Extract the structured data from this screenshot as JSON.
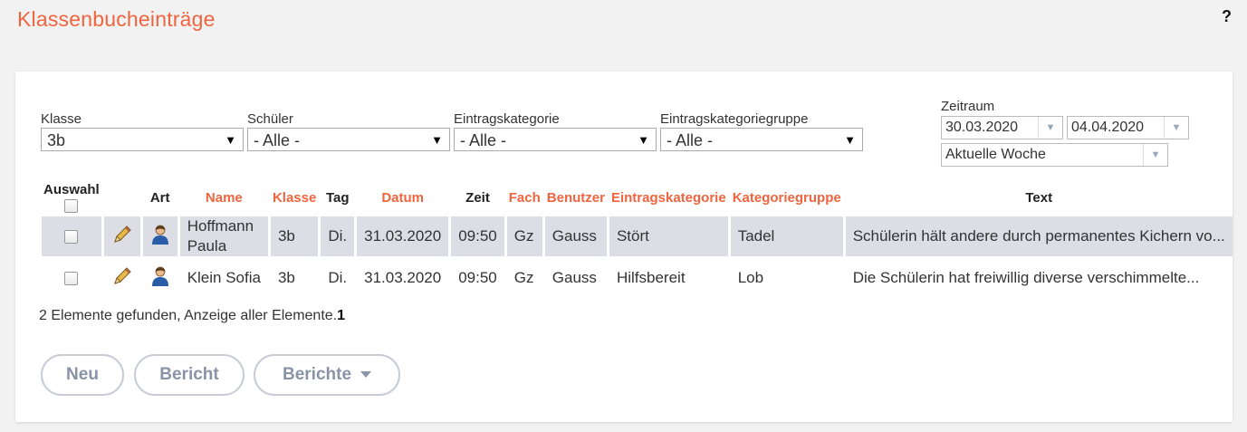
{
  "header": {
    "title": "Klassenbucheinträge",
    "help": "?"
  },
  "filters": {
    "klasse": {
      "label": "Klasse",
      "value": "3b"
    },
    "schueler": {
      "label": "Schüler",
      "value": "- Alle -"
    },
    "kategorie": {
      "label": "Eintragskategorie",
      "value": "- Alle -"
    },
    "gruppe": {
      "label": "Eintragskategoriegruppe",
      "value": "- Alle -"
    },
    "zeitraum": {
      "label": "Zeitraum",
      "from": "30.03.2020",
      "to": "04.04.2020",
      "preset": "Aktuelle Woche"
    }
  },
  "table": {
    "columns": {
      "auswahl": "Auswahl",
      "art": "Art",
      "name": "Name",
      "klasse": "Klasse",
      "tag": "Tag",
      "datum": "Datum",
      "zeit": "Zeit",
      "fach": "Fach",
      "benutzer": "Benutzer",
      "kategorie": "Eintragskategorie",
      "gruppe": "Kategoriegruppe",
      "text": "Text"
    },
    "rows": [
      {
        "name": "Hoffmann Paula",
        "klasse": "3b",
        "tag": "Di.",
        "datum": "31.03.2020",
        "zeit": "09:50",
        "fach": "Gz",
        "benutzer": "Gauss",
        "kategorie": "Stört",
        "gruppe": "Tadel",
        "text": "Schülerin hält andere durch permanentes Kichern vo..."
      },
      {
        "name": "Klein Sofia",
        "klasse": "3b",
        "tag": "Di.",
        "datum": "31.03.2020",
        "zeit": "09:50",
        "fach": "Gz",
        "benutzer": "Gauss",
        "kategorie": "Hilfsbereit",
        "gruppe": "Lob",
        "text": "Die Schülerin hat freiwillig diverse verschimmelte..."
      }
    ]
  },
  "status": {
    "text": "2 Elemente gefunden, Anzeige aller Elemente.",
    "page": "1"
  },
  "buttons": {
    "neu": "Neu",
    "bericht": "Bericht",
    "berichte": "Berichte"
  },
  "icons": {
    "edit": "pencil-icon",
    "type": "person-icon",
    "dropdown": "triangle-down-icon"
  },
  "colors": {
    "accent": "#f0643f",
    "row_highlight": "#dcdde5",
    "button_text": "#8a93a6"
  }
}
